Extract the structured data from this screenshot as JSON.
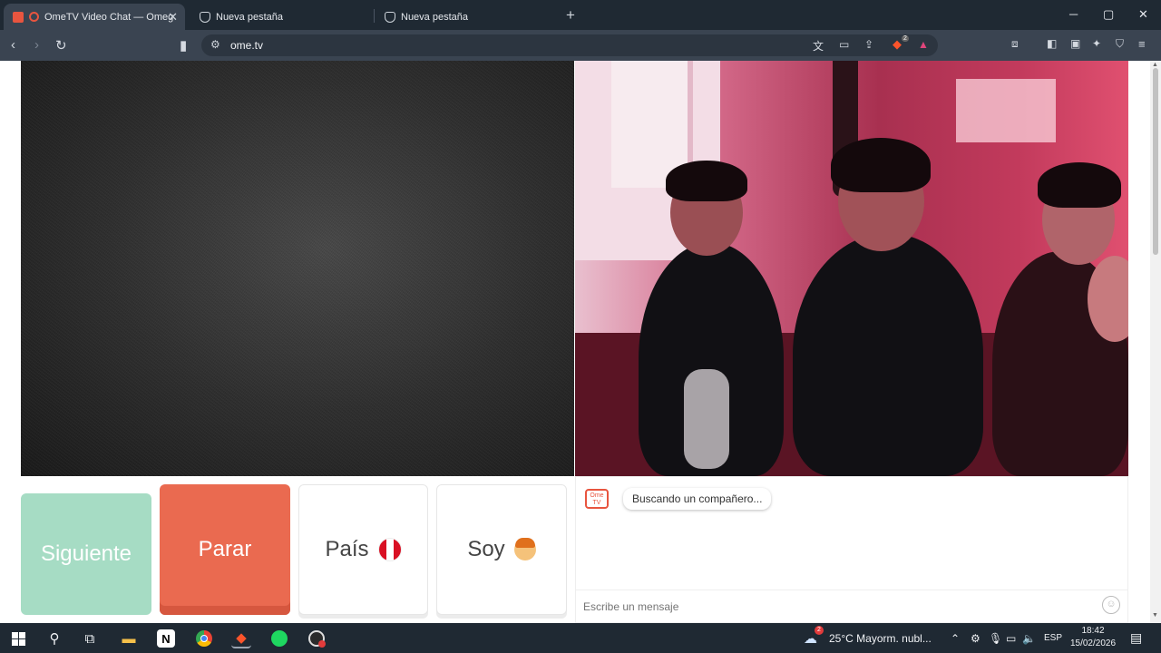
{
  "browser": {
    "tabs": [
      {
        "title": "OmeTV Video Chat — Omeg",
        "active": true
      },
      {
        "title": "Nueva pestaña",
        "active": false
      },
      {
        "title": "Nueva pestaña",
        "active": false
      }
    ],
    "new_tab_symbol": "+",
    "address": "ome.tv",
    "brave_badge_count": "2"
  },
  "controls": {
    "next_label": "Siguiente",
    "stop_label": "Parar",
    "country_label": "País",
    "country_flag": "Peru",
    "gender_label": "Soy"
  },
  "chat": {
    "logo_text": "Ome TV",
    "status_message": "Buscando un compañero...",
    "input_placeholder": "Escribe un mensaje"
  },
  "taskbar": {
    "weather_alert_count": "2",
    "weather": "25°C  Mayorm. nubl...",
    "language": "ESP",
    "time": "18:42",
    "date": "15/02/2026"
  },
  "colors": {
    "next_button": "#a6dcc4",
    "stop_button": "#ea6a50",
    "brand_orange": "#e8553f"
  }
}
